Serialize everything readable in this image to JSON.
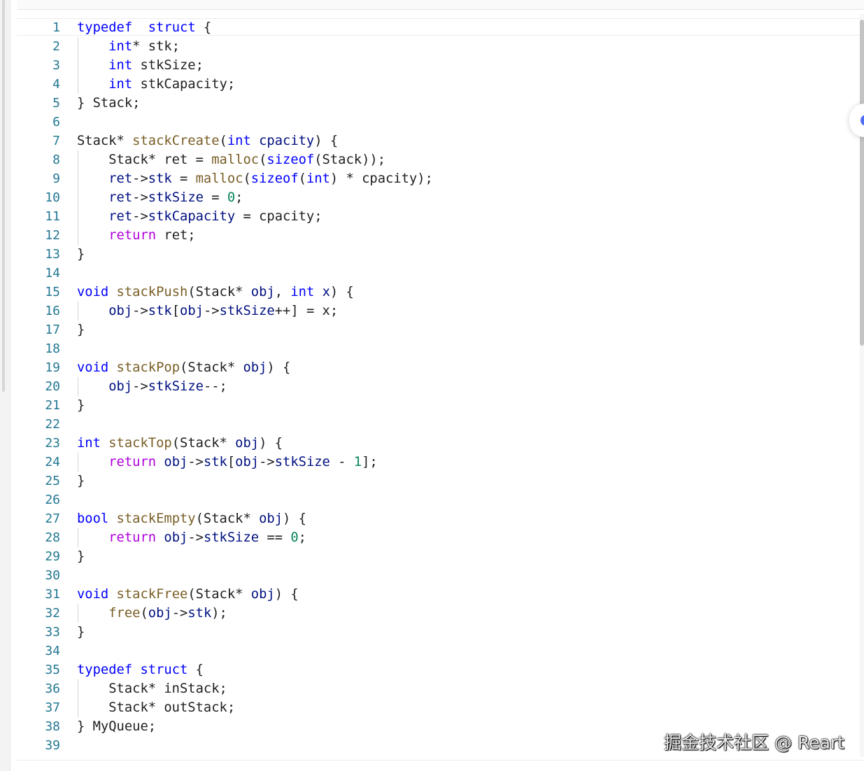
{
  "editor": {
    "language": "c",
    "lines": [
      {
        "num": "1",
        "indent": false,
        "tokens": [
          [
            "kw",
            "typedef"
          ],
          [
            "",
            "  "
          ],
          [
            "kw",
            "struct"
          ],
          [
            "",
            " {"
          ]
        ]
      },
      {
        "num": "2",
        "indent": true,
        "tokens": [
          [
            "",
            "    "
          ],
          [
            "kw",
            "int"
          ],
          [
            "",
            "* stk;"
          ]
        ]
      },
      {
        "num": "3",
        "indent": true,
        "tokens": [
          [
            "",
            "    "
          ],
          [
            "kw",
            "int"
          ],
          [
            "",
            " stkSize;"
          ]
        ]
      },
      {
        "num": "4",
        "indent": true,
        "tokens": [
          [
            "",
            "    "
          ],
          [
            "kw",
            "int"
          ],
          [
            "",
            " stkCapacity;"
          ]
        ]
      },
      {
        "num": "5",
        "indent": false,
        "tokens": [
          [
            "",
            "} Stack;"
          ]
        ]
      },
      {
        "num": "6",
        "indent": false,
        "tokens": []
      },
      {
        "num": "7",
        "indent": false,
        "tokens": [
          [
            "",
            "Stack* "
          ],
          [
            "fn",
            "stackCreate"
          ],
          [
            "",
            "("
          ],
          [
            "kw",
            "int"
          ],
          [
            "",
            " "
          ],
          [
            "var",
            "cpacity"
          ],
          [
            "",
            ") {"
          ]
        ]
      },
      {
        "num": "8",
        "indent": true,
        "tokens": [
          [
            "",
            "    Stack* ret = "
          ],
          [
            "fn",
            "malloc"
          ],
          [
            "",
            "("
          ],
          [
            "kw",
            "sizeof"
          ],
          [
            "",
            "(Stack));"
          ]
        ]
      },
      {
        "num": "9",
        "indent": true,
        "tokens": [
          [
            "",
            "    "
          ],
          [
            "var",
            "ret"
          ],
          [
            "",
            "->"
          ],
          [
            "var",
            "stk"
          ],
          [
            "",
            " = "
          ],
          [
            "fn",
            "malloc"
          ],
          [
            "",
            "("
          ],
          [
            "kw",
            "sizeof"
          ],
          [
            "",
            "("
          ],
          [
            "kw",
            "int"
          ],
          [
            "",
            ") * cpacity);"
          ]
        ]
      },
      {
        "num": "10",
        "indent": true,
        "tokens": [
          [
            "",
            "    "
          ],
          [
            "var",
            "ret"
          ],
          [
            "",
            "->"
          ],
          [
            "var",
            "stkSize"
          ],
          [
            "",
            " = "
          ],
          [
            "num",
            "0"
          ],
          [
            "",
            ";"
          ]
        ]
      },
      {
        "num": "11",
        "indent": true,
        "tokens": [
          [
            "",
            "    "
          ],
          [
            "var",
            "ret"
          ],
          [
            "",
            "->"
          ],
          [
            "var",
            "stkCapacity"
          ],
          [
            "",
            " = cpacity;"
          ]
        ]
      },
      {
        "num": "12",
        "indent": true,
        "tokens": [
          [
            "",
            "    "
          ],
          [
            "ctl",
            "return"
          ],
          [
            "",
            " ret;"
          ]
        ]
      },
      {
        "num": "13",
        "indent": false,
        "tokens": [
          [
            "",
            "}"
          ]
        ]
      },
      {
        "num": "14",
        "indent": false,
        "tokens": []
      },
      {
        "num": "15",
        "indent": false,
        "tokens": [
          [
            "kw",
            "void"
          ],
          [
            "",
            " "
          ],
          [
            "fn",
            "stackPush"
          ],
          [
            "",
            "(Stack* "
          ],
          [
            "var",
            "obj"
          ],
          [
            "",
            ", "
          ],
          [
            "kw",
            "int"
          ],
          [
            "",
            " "
          ],
          [
            "var",
            "x"
          ],
          [
            "",
            ") {"
          ]
        ]
      },
      {
        "num": "16",
        "indent": true,
        "tokens": [
          [
            "",
            "    "
          ],
          [
            "var",
            "obj"
          ],
          [
            "",
            "->"
          ],
          [
            "var",
            "stk"
          ],
          [
            "",
            "["
          ],
          [
            "var",
            "obj"
          ],
          [
            "",
            "->"
          ],
          [
            "var",
            "stkSize"
          ],
          [
            "",
            "++] = x;"
          ]
        ]
      },
      {
        "num": "17",
        "indent": false,
        "tokens": [
          [
            "",
            "}"
          ]
        ]
      },
      {
        "num": "18",
        "indent": false,
        "tokens": []
      },
      {
        "num": "19",
        "indent": false,
        "tokens": [
          [
            "kw",
            "void"
          ],
          [
            "",
            " "
          ],
          [
            "fn",
            "stackPop"
          ],
          [
            "",
            "(Stack* "
          ],
          [
            "var",
            "obj"
          ],
          [
            "",
            ") {"
          ]
        ]
      },
      {
        "num": "20",
        "indent": true,
        "tokens": [
          [
            "",
            "    "
          ],
          [
            "var",
            "obj"
          ],
          [
            "",
            "->"
          ],
          [
            "var",
            "stkSize"
          ],
          [
            "",
            "--;"
          ]
        ]
      },
      {
        "num": "21",
        "indent": false,
        "tokens": [
          [
            "",
            "}"
          ]
        ]
      },
      {
        "num": "22",
        "indent": false,
        "tokens": []
      },
      {
        "num": "23",
        "indent": false,
        "tokens": [
          [
            "kw",
            "int"
          ],
          [
            "",
            " "
          ],
          [
            "fn",
            "stackTop"
          ],
          [
            "",
            "(Stack* "
          ],
          [
            "var",
            "obj"
          ],
          [
            "",
            ") {"
          ]
        ]
      },
      {
        "num": "24",
        "indent": true,
        "tokens": [
          [
            "",
            "    "
          ],
          [
            "ctl",
            "return"
          ],
          [
            "",
            " "
          ],
          [
            "var",
            "obj"
          ],
          [
            "",
            "->"
          ],
          [
            "var",
            "stk"
          ],
          [
            "",
            "["
          ],
          [
            "var",
            "obj"
          ],
          [
            "",
            "->"
          ],
          [
            "var",
            "stkSize"
          ],
          [
            "",
            " - "
          ],
          [
            "num",
            "1"
          ],
          [
            "",
            "];"
          ]
        ]
      },
      {
        "num": "25",
        "indent": false,
        "tokens": [
          [
            "",
            "}"
          ]
        ]
      },
      {
        "num": "26",
        "indent": false,
        "tokens": []
      },
      {
        "num": "27",
        "indent": false,
        "tokens": [
          [
            "kw",
            "bool"
          ],
          [
            "",
            " "
          ],
          [
            "fn",
            "stackEmpty"
          ],
          [
            "",
            "(Stack* "
          ],
          [
            "var",
            "obj"
          ],
          [
            "",
            ") {"
          ]
        ]
      },
      {
        "num": "28",
        "indent": true,
        "tokens": [
          [
            "",
            "    "
          ],
          [
            "ctl",
            "return"
          ],
          [
            "",
            " "
          ],
          [
            "var",
            "obj"
          ],
          [
            "",
            "->"
          ],
          [
            "var",
            "stkSize"
          ],
          [
            "",
            " == "
          ],
          [
            "num",
            "0"
          ],
          [
            "",
            ";"
          ]
        ]
      },
      {
        "num": "29",
        "indent": false,
        "tokens": [
          [
            "",
            "}"
          ]
        ]
      },
      {
        "num": "30",
        "indent": false,
        "tokens": []
      },
      {
        "num": "31",
        "indent": false,
        "tokens": [
          [
            "kw",
            "void"
          ],
          [
            "",
            " "
          ],
          [
            "fn",
            "stackFree"
          ],
          [
            "",
            "(Stack* "
          ],
          [
            "var",
            "obj"
          ],
          [
            "",
            ") {"
          ]
        ]
      },
      {
        "num": "32",
        "indent": true,
        "tokens": [
          [
            "",
            "    "
          ],
          [
            "fn",
            "free"
          ],
          [
            "",
            "("
          ],
          [
            "var",
            "obj"
          ],
          [
            "",
            "->"
          ],
          [
            "var",
            "stk"
          ],
          [
            "",
            ");"
          ]
        ]
      },
      {
        "num": "33",
        "indent": false,
        "tokens": [
          [
            "",
            "}"
          ]
        ]
      },
      {
        "num": "34",
        "indent": false,
        "tokens": []
      },
      {
        "num": "35",
        "indent": false,
        "tokens": [
          [
            "kw",
            "typedef"
          ],
          [
            "",
            " "
          ],
          [
            "kw",
            "struct"
          ],
          [
            "",
            " {"
          ]
        ]
      },
      {
        "num": "36",
        "indent": true,
        "tokens": [
          [
            "",
            "    Stack* inStack;"
          ]
        ]
      },
      {
        "num": "37",
        "indent": true,
        "tokens": [
          [
            "",
            "    Stack* outStack;"
          ]
        ]
      },
      {
        "num": "38",
        "indent": false,
        "tokens": [
          [
            "",
            "} MyQueue;"
          ]
        ]
      },
      {
        "num": "39",
        "indent": false,
        "tokens": []
      }
    ]
  },
  "watermark": "掘金技术社区 @ Reart",
  "colors": {
    "keyword": "#0000ff",
    "control": "#af00db",
    "function": "#795e26",
    "variable": "#001080",
    "number": "#098658",
    "line_number": "#237893"
  },
  "icons": {
    "floating_button": "circle-button-icon"
  }
}
